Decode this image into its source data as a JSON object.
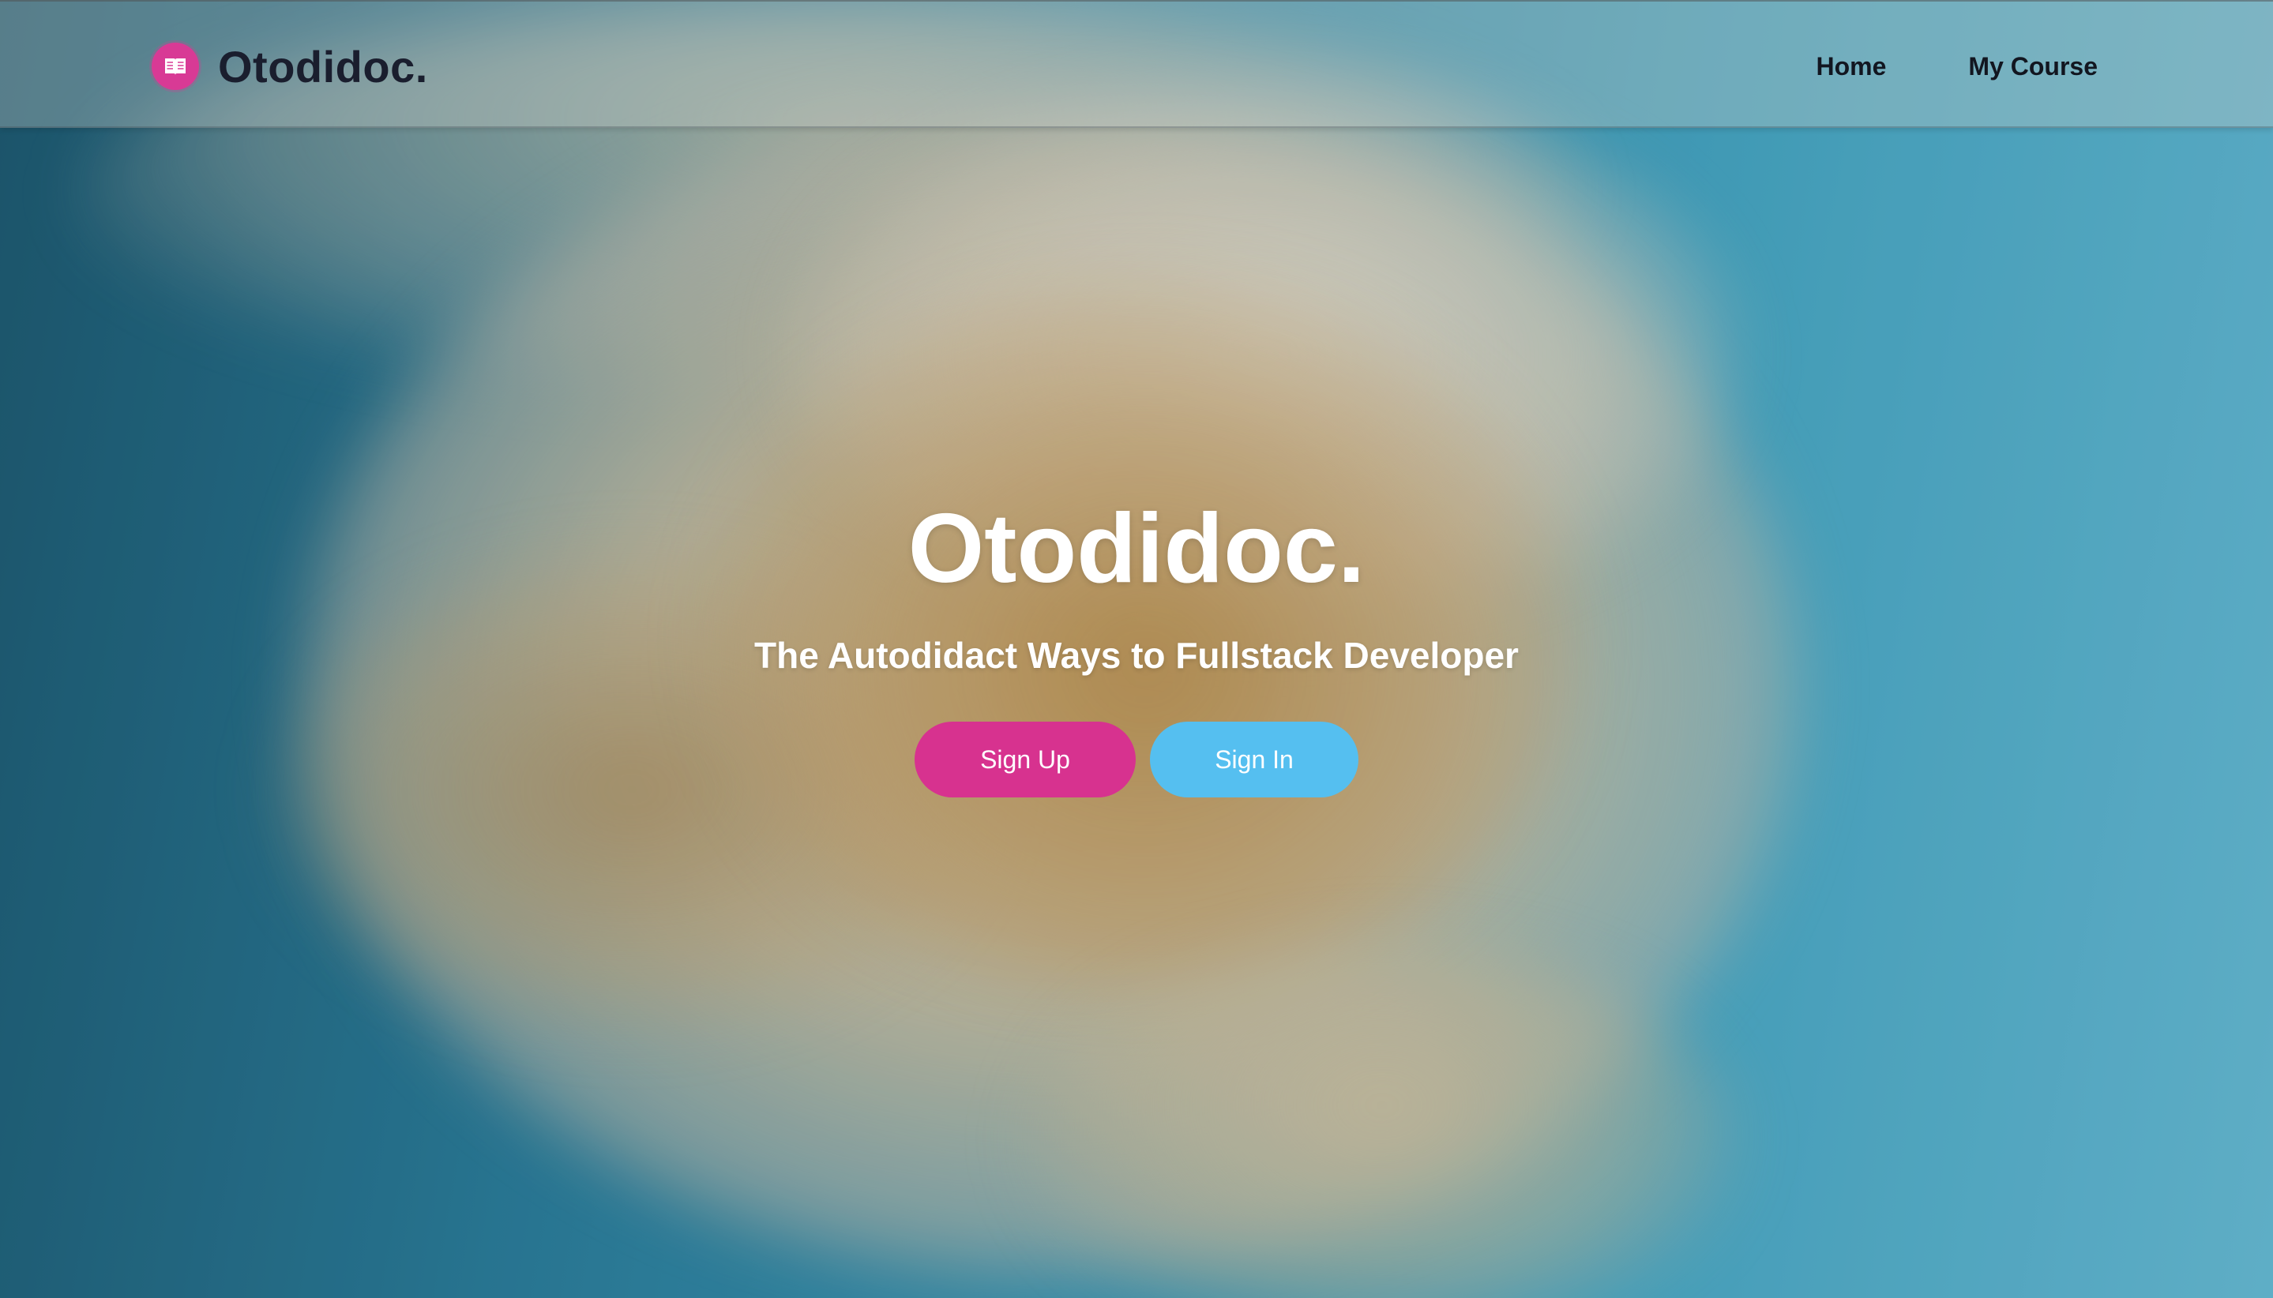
{
  "navbar": {
    "brand_name": "Otodidoc.",
    "brand_icon": "open-book-icon",
    "links": [
      {
        "label": "Home"
      },
      {
        "label": "My Course"
      }
    ]
  },
  "hero": {
    "title": "Otodidoc.",
    "subtitle": "The Autodidact Ways to Fullstack Developer",
    "buttons": {
      "signup_label": "Sign Up",
      "signin_label": "Sign In"
    }
  },
  "colors": {
    "brand_pink": "#d7328f",
    "signin_blue": "#55bff0",
    "nav_text": "#121620"
  }
}
